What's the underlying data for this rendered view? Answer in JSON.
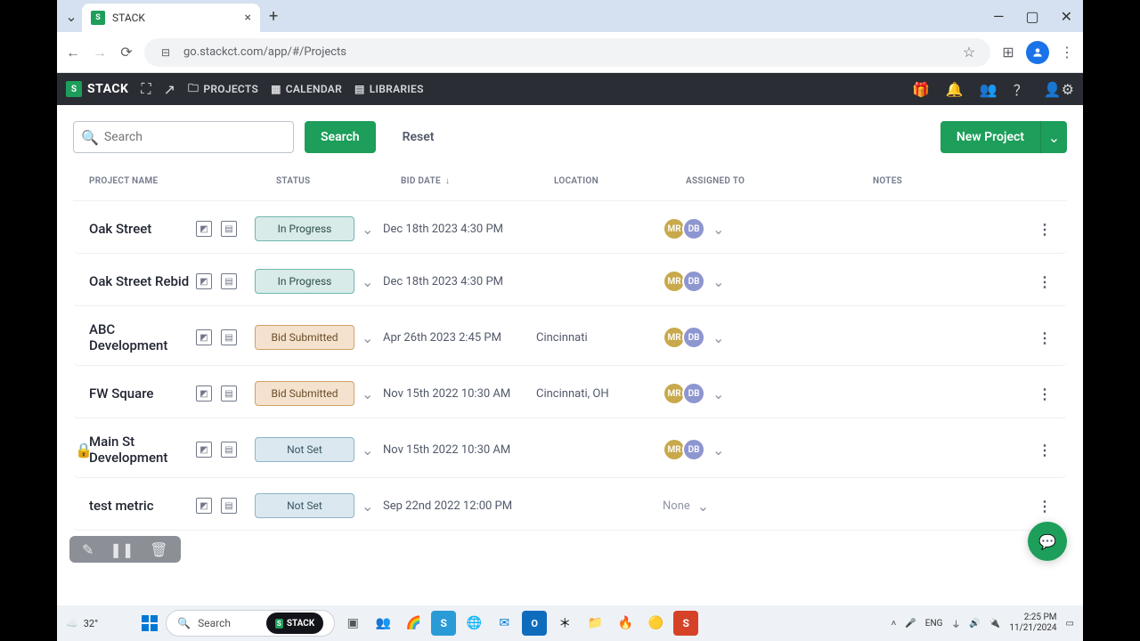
{
  "browser": {
    "tab_title": "STACK",
    "url": "go.stackct.com/app/#/Projects"
  },
  "header": {
    "logo": "STACK",
    "nav": {
      "projects": "PROJECTS",
      "calendar": "CALENDAR",
      "libraries": "LIBRARIES"
    }
  },
  "toolbar": {
    "search_placeholder": "Search",
    "search_btn": "Search",
    "reset_btn": "Reset",
    "new_project": "New Project"
  },
  "columns": {
    "name": "PROJECT NAME",
    "status": "STATUS",
    "bid": "BID DATE",
    "location": "LOCATION",
    "assigned": "ASSIGNED TO",
    "notes": "NOTES"
  },
  "status_labels": {
    "in_progress": "In Progress",
    "bid_submitted": "Bid Submitted",
    "not_set": "Not Set"
  },
  "avatars": {
    "mr": "MR",
    "db": "DB"
  },
  "rows": [
    {
      "name": "Oak Street",
      "status": "in_progress",
      "bid": "Dec 18th 2023 4:30 PM",
      "location": "",
      "assigned": "mrdb",
      "locked": false
    },
    {
      "name": "Oak Street Rebid",
      "status": "in_progress",
      "bid": "Dec 18th 2023 4:30 PM",
      "location": "",
      "assigned": "mrdb",
      "locked": false
    },
    {
      "name": "ABC Development",
      "status": "bid_submitted",
      "bid": "Apr 26th 2023 2:45 PM",
      "location": "Cincinnati",
      "assigned": "mrdb",
      "locked": false
    },
    {
      "name": "FW Square",
      "status": "bid_submitted",
      "bid": "Nov 15th 2022 10:30 AM",
      "location": "Cincinnati, OH",
      "assigned": "mrdb",
      "locked": false
    },
    {
      "name": "Main St Development",
      "status": "not_set",
      "bid": "Nov 15th 2022 10:30 AM",
      "location": "",
      "assigned": "mrdb",
      "locked": true
    },
    {
      "name": "test metric",
      "status": "not_set",
      "bid": "Sep 22nd 2022 12:00 PM",
      "location": "",
      "assigned": "none",
      "locked": false
    }
  ],
  "none_label": "None",
  "taskbar": {
    "weather": "32°",
    "search": "Search",
    "stack_pill": "STACK",
    "lang": "ENG",
    "time": "2:25 PM",
    "date": "11/21/2024"
  }
}
